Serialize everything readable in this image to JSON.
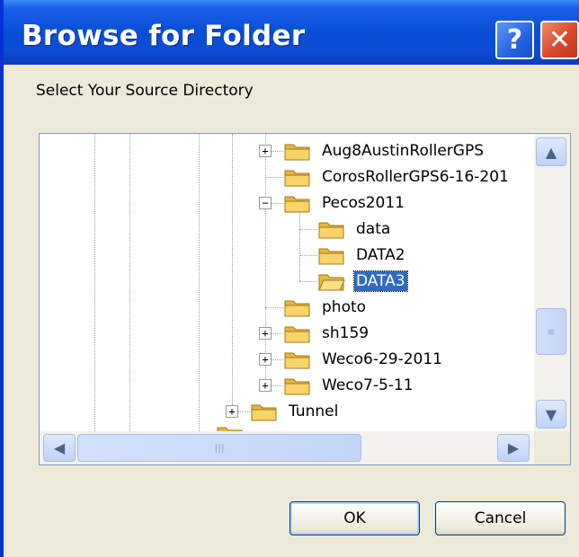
{
  "window": {
    "title": "Browse for Folder",
    "help_glyph": "?",
    "close_glyph": "✕"
  },
  "prompt": "Select Your Source Directory",
  "tree": {
    "nodes": [
      {
        "label": "Aug8AustinRollerGPS",
        "expander": "+"
      },
      {
        "label": "CorosRollerGPS6-16-201",
        "expander": ""
      },
      {
        "label": "Pecos2011",
        "expander": "−"
      },
      {
        "label": "data",
        "expander": ""
      },
      {
        "label": "DATA2",
        "expander": ""
      },
      {
        "label": "DATA3",
        "expander": "",
        "selected": true
      },
      {
        "label": "photo",
        "expander": ""
      },
      {
        "label": "sh159",
        "expander": "+"
      },
      {
        "label": "Weco6-29-2011",
        "expander": "+"
      },
      {
        "label": "Weco7-5-11",
        "expander": "+"
      },
      {
        "label": "Tunnel",
        "expander": "+"
      }
    ],
    "folder_icon": "folder-icon",
    "selected_color": "#316ac5"
  },
  "scrollbars": {
    "up": "▲",
    "down": "▼",
    "left": "◀",
    "right": "▶",
    "grip_v": "≡",
    "grip_h": "|||"
  },
  "buttons": {
    "ok": "OK",
    "cancel": "Cancel"
  },
  "colors": {
    "titlebar": "#0a4fd8",
    "dialog_bg": "#ece9d8",
    "close": "#d8492a"
  }
}
